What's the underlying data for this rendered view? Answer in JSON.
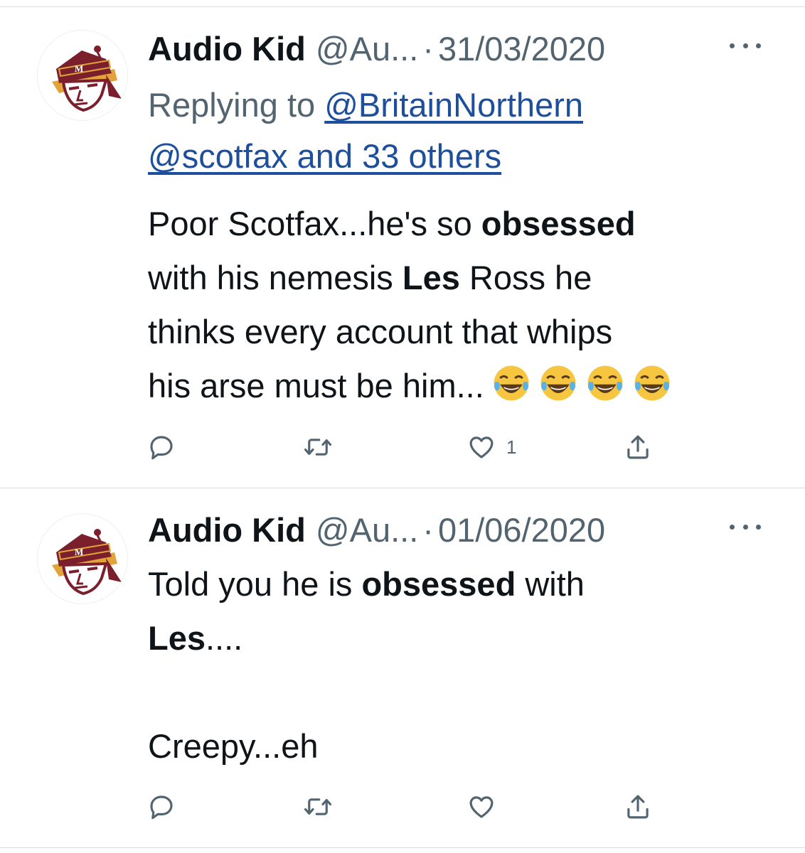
{
  "tweets": [
    {
      "name": "Audio Kid",
      "handle": "@Au...",
      "separator": "·",
      "date": "31/03/2020",
      "replying_prefix": "Replying to",
      "replying_user": "@BritainNorthern",
      "replying_others": "@scotfax and 33 others",
      "body": {
        "line1_a": "Poor Scotfax...he's so ",
        "line1_b": "obsessed",
        "line2_a": "with his nemesis ",
        "line2_b": "Les",
        "line2_c": " Ross he",
        "line3": "thinks every account that whips",
        "line4": "his arse must be him..."
      },
      "emoji": [
        "face-with-tears-of-joy",
        "face-with-tears-of-joy",
        "face-with-tears-of-joy",
        "face-with-tears-of-joy"
      ],
      "like_count": "1",
      "icons": [
        "reply-icon",
        "retweet-icon",
        "heart-icon",
        "share-icon"
      ]
    },
    {
      "name": "Audio Kid",
      "handle": "@Au...",
      "separator": "·",
      "date": "01/06/2020",
      "body": {
        "line1_a": "Told you he is ",
        "line1_b": "obsessed",
        "line1_c": " with",
        "line2_a": "Les",
        "line2_b": "....",
        "line3": "Creepy...eh"
      },
      "like_count": "",
      "icons": [
        "reply-icon",
        "retweet-icon",
        "heart-icon",
        "share-icon"
      ]
    }
  ],
  "colors": {
    "text": "#0f1419",
    "secondary": "#536471",
    "link": "#1d4f9c",
    "divider": "#d9dde1",
    "avatar_maroon": "#7a1f2b",
    "avatar_gold": "#e2a33a"
  }
}
